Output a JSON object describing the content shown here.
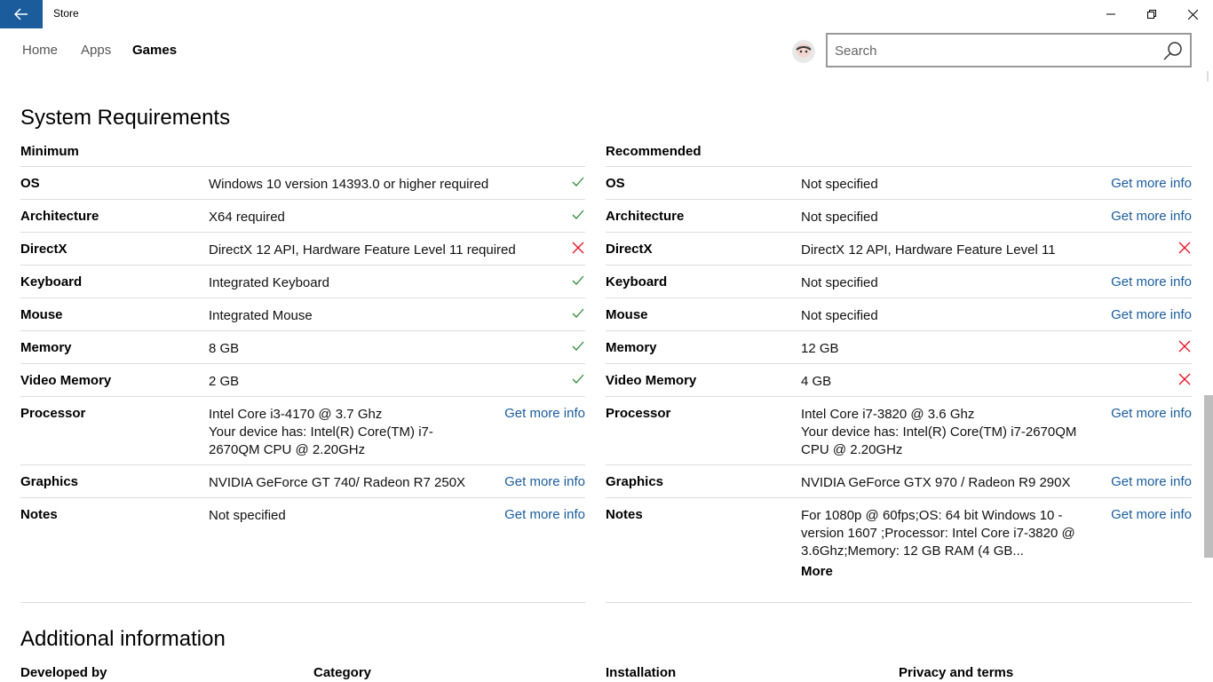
{
  "window": {
    "title": "Store"
  },
  "nav": {
    "items": [
      {
        "label": "Home"
      },
      {
        "label": "Apps"
      },
      {
        "label": "Games"
      }
    ],
    "search_placeholder": "Search"
  },
  "system_requirements": {
    "title": "System Requirements",
    "minimum": {
      "heading": "Minimum",
      "rows": [
        {
          "label": "OS",
          "value": "Windows 10 version 14393.0 or higher required",
          "status": "check"
        },
        {
          "label": "Architecture",
          "value": "X64 required",
          "status": "check"
        },
        {
          "label": "DirectX",
          "value": "DirectX 12 API, Hardware Feature Level 11 required",
          "status": "cross"
        },
        {
          "label": "Keyboard",
          "value": "Integrated Keyboard",
          "status": "check"
        },
        {
          "label": "Mouse",
          "value": "Integrated Mouse",
          "status": "check"
        },
        {
          "label": "Memory",
          "value": "8 GB",
          "status": "check"
        },
        {
          "label": "Video Memory",
          "value": "2 GB",
          "status": "check"
        },
        {
          "label": "Processor",
          "value": "Intel Core i3-4170 @ 3.7 Ghz",
          "value2": "Your device has: Intel(R) Core(TM) i7-2670QM CPU @ 2.20GHz",
          "link": "Get more info"
        },
        {
          "label": "Graphics",
          "value": "NVIDIA GeForce GT 740/ Radeon R7 250X",
          "link": "Get more info"
        },
        {
          "label": "Notes",
          "value": "Not specified",
          "link": "Get more info"
        }
      ]
    },
    "recommended": {
      "heading": "Recommended",
      "rows": [
        {
          "label": "OS",
          "value": "Not specified",
          "link": "Get more info"
        },
        {
          "label": "Architecture",
          "value": "Not specified",
          "link": "Get more info"
        },
        {
          "label": "DirectX",
          "value": "DirectX 12 API, Hardware Feature Level 11",
          "status": "cross"
        },
        {
          "label": "Keyboard",
          "value": "Not specified",
          "link": "Get more info"
        },
        {
          "label": "Mouse",
          "value": "Not specified",
          "link": "Get more info"
        },
        {
          "label": "Memory",
          "value": "12 GB",
          "status": "cross"
        },
        {
          "label": "Video Memory",
          "value": "4 GB",
          "status": "cross"
        },
        {
          "label": "Processor",
          "value": "Intel Core i7-3820 @ 3.6 Ghz",
          "value2": "Your device has: Intel(R) Core(TM) i7-2670QM CPU @ 2.20GHz",
          "link": "Get more info"
        },
        {
          "label": "Graphics",
          "value": "NVIDIA GeForce GTX 970 / Radeon R9 290X",
          "link": "Get more info"
        },
        {
          "label": "Notes",
          "value": "For 1080p @ 60fps;OS: 64 bit Windows 10 - version 1607 ;Processor: Intel Core i7-3820 @ 3.6Ghz;Memory: 12 GB RAM (4 GB...",
          "link": "Get more info",
          "more": "More"
        }
      ]
    }
  },
  "additional_info": {
    "title": "Additional information",
    "columns": [
      {
        "label": "Developed by"
      },
      {
        "label": "Category"
      },
      {
        "label": "Installation"
      },
      {
        "label": "Privacy and terms"
      }
    ]
  },
  "colors": {
    "accent": "#1b5d9c",
    "check": "#2e8b3a",
    "cross": "#e81123"
  }
}
